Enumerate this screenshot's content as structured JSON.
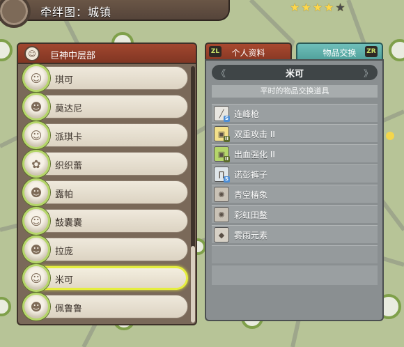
{
  "header": {
    "title": "牵绊图：城镇",
    "stars": [
      true,
      true,
      true,
      true,
      false
    ]
  },
  "colors": {
    "accent_red": "#8a3a26",
    "accent_teal": "#5fb0ab",
    "selection_yellow": "#e5ee3f"
  },
  "left_panel": {
    "category_icon": "character-icon",
    "category_label": "巨神中层部",
    "npcs": [
      {
        "name": "琪可",
        "selected": false
      },
      {
        "name": "莫达尼",
        "selected": false
      },
      {
        "name": "派琪卡",
        "selected": false
      },
      {
        "name": "织织蕾",
        "selected": false
      },
      {
        "name": "露帕",
        "selected": false
      },
      {
        "name": "鼓囊囊",
        "selected": false
      },
      {
        "name": "拉庞",
        "selected": false
      },
      {
        "name": "米可",
        "selected": true
      },
      {
        "name": "佩鲁鲁",
        "selected": false
      }
    ]
  },
  "tabs": [
    {
      "key": "ZL",
      "label": "个人资料",
      "active": false
    },
    {
      "key": "ZR",
      "label": "物品交换",
      "active": true
    }
  ],
  "exchange": {
    "npc_name": "米可",
    "subtitle": "平时的物品交换道具",
    "items": [
      {
        "name": "连峰枪",
        "icon": "weapon-icon",
        "grade": "S"
      },
      {
        "name": "双重攻击 II",
        "icon": "armor-icon",
        "grade": "II"
      },
      {
        "name": "出血强化 II",
        "icon": "armor-icon",
        "grade": "II"
      },
      {
        "name": "诺彭裤子",
        "icon": "pants-icon",
        "grade": "S"
      },
      {
        "name": "青空椿象",
        "icon": "bug-icon",
        "grade": ""
      },
      {
        "name": "彩虹田鳖",
        "icon": "bug-icon",
        "grade": ""
      },
      {
        "name": "雾雨元素",
        "icon": "material-icon",
        "grade": ""
      }
    ]
  }
}
